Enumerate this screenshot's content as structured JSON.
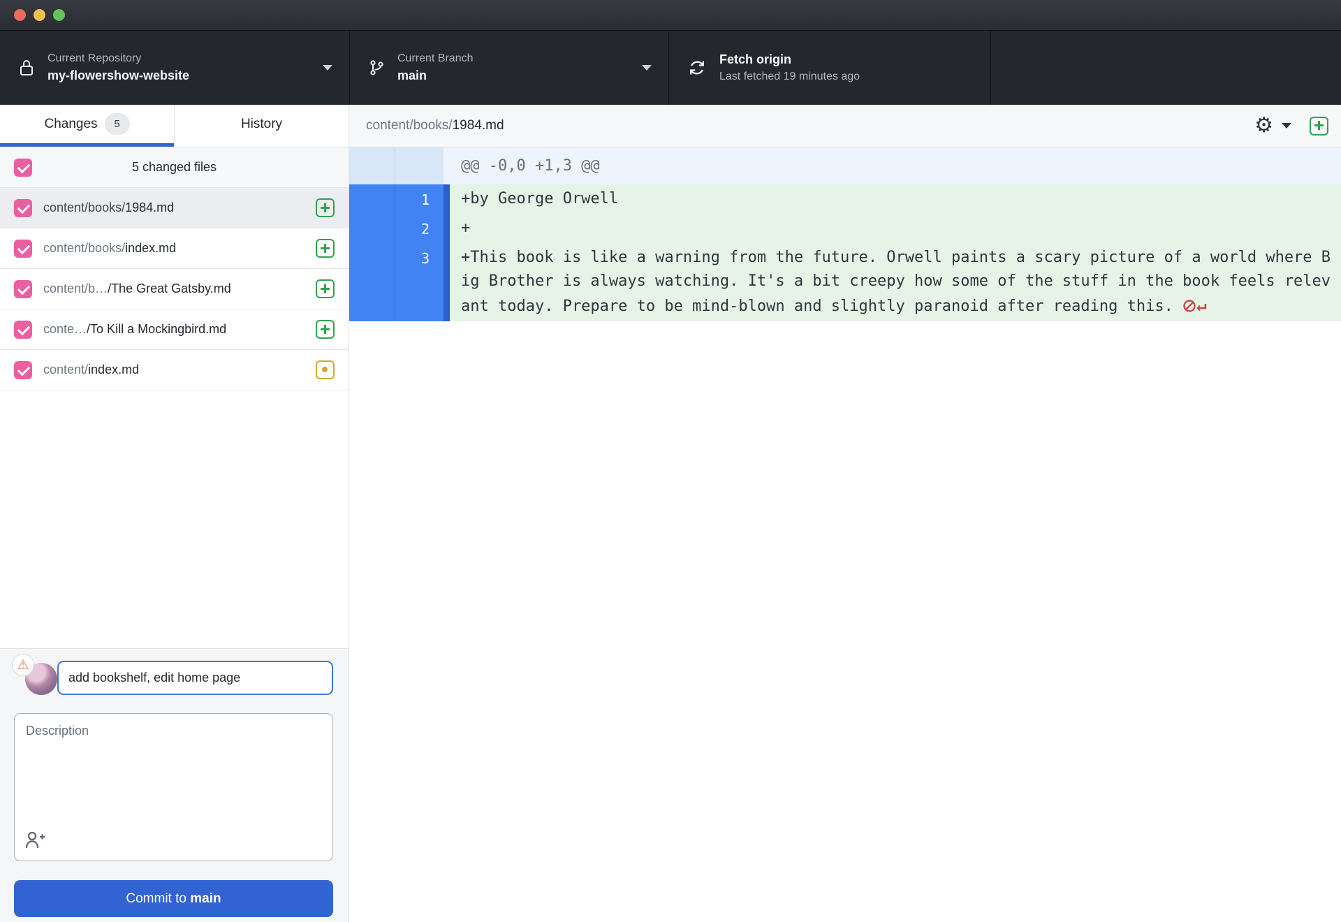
{
  "window": {
    "controls": [
      "close",
      "minimize",
      "zoom"
    ]
  },
  "toolbar": {
    "repository": {
      "label": "Current Repository",
      "value": "my-flowershow-website"
    },
    "branch": {
      "label": "Current Branch",
      "value": "main"
    },
    "fetch": {
      "title": "Fetch origin",
      "subtitle": "Last fetched 19 minutes ago"
    }
  },
  "sidebar": {
    "tabs": [
      {
        "label": "Changes",
        "badge": "5",
        "active": true
      },
      {
        "label": "History",
        "active": false
      }
    ],
    "files_header": "5 changed files",
    "files": [
      {
        "dir": "content/books/",
        "name": "1984.md",
        "status": "added",
        "checked": true,
        "selected": true
      },
      {
        "dir": "content/books/",
        "name": "index.md",
        "status": "added",
        "checked": true,
        "selected": false
      },
      {
        "dir": "content/b…",
        "name": "/The Great Gatsby.md",
        "status": "added",
        "checked": true,
        "selected": false
      },
      {
        "dir": "conte…",
        "name": "/To Kill a Mockingbird.md",
        "status": "added",
        "checked": true,
        "selected": false
      },
      {
        "dir": "content/",
        "name": "index.md",
        "status": "modified",
        "checked": true,
        "selected": false
      }
    ],
    "commit": {
      "summary_value": "add bookshelf, edit home page",
      "description_placeholder": "Description",
      "button_prefix": "Commit to ",
      "button_branch": "main"
    }
  },
  "diff": {
    "file_dir": "content/books/",
    "file_name": "1984.md",
    "hunk_header": "@@ -0,0 +1,3 @@",
    "lines": [
      {
        "new_line": "1",
        "text": "+by George Orwell",
        "no_newline": false
      },
      {
        "new_line": "2",
        "text": "+",
        "no_newline": false
      },
      {
        "new_line": "3",
        "text": "+This book is like a warning from the future. Orwell paints a scary picture of a world where Big Brother is always watching. It's a bit creepy how some of the stuff in the book feels relevant today. Prepare to be mind-blown and slightly paranoid after reading this.",
        "no_newline": true
      }
    ]
  },
  "icons": {
    "gear": "⚙",
    "warning": "⚠",
    "return_arrow": "↵"
  },
  "colors": {
    "accent_blue": "#3064d6",
    "checkbox_pink": "#ea5fa2",
    "added_green": "#2da44e",
    "modified_yellow": "#d4a72c",
    "focus_blue": "#3a76dd",
    "button_blue": "#3263d3",
    "warning_orange": "#e8833a",
    "sel_gutter": "#4183f3",
    "hunk_gutter": "#d9e6f8",
    "hunk_bg": "#edf4fd",
    "added_bg": "#e6f4e8",
    "nonl_red": "#cb4848"
  }
}
